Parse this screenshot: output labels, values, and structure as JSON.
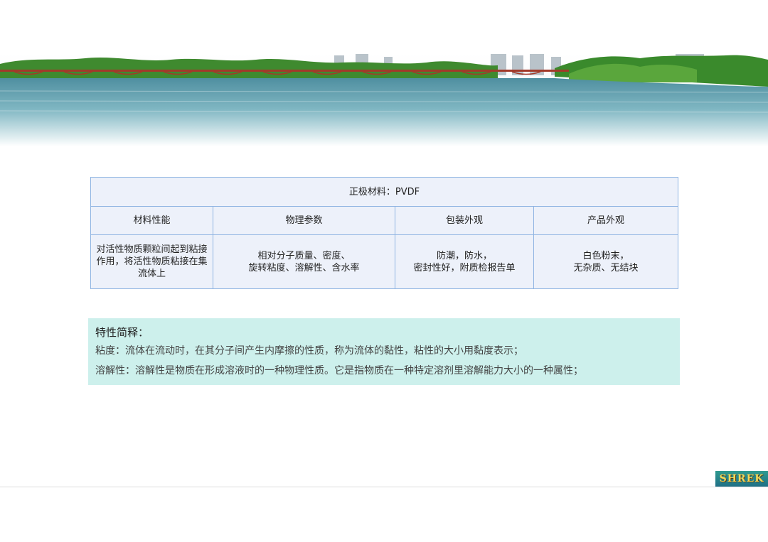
{
  "table": {
    "title": "正极材料：PVDF",
    "headers": [
      "材料性能",
      "物理参数",
      "包装外观",
      "产品外观"
    ],
    "cells": [
      "对活性物质颗粒间起到粘接\n作用，将活性物质粘接在集\n流体上",
      "相对分子质量、密度、\n旋转粘度、溶解性、含水率",
      "防潮，防水，\n密封性好，附质检报告单",
      "白色粉末，\n无杂质、无结块"
    ]
  },
  "notes": {
    "title": "特性简释：",
    "lines": [
      "粘度：流体在流动时，在其分子间产生内摩擦的性质，称为流体的黏性，粘性的大小用黏度表示；",
      "溶解性：溶解性是物质在形成溶液时的一种物理性质。它是指物质在一种特定溶剂里溶解能力大小的一种属性；"
    ]
  },
  "logo": {
    "text": "SHREK"
  },
  "colors": {
    "table_border": "#8fb4e2",
    "table_fill": "#edf1fa",
    "notes_fill": "#cdf0ec",
    "water": "#6aa9b8",
    "trees": "#3e8a2e",
    "logo_bg": "#2f9a8f"
  }
}
